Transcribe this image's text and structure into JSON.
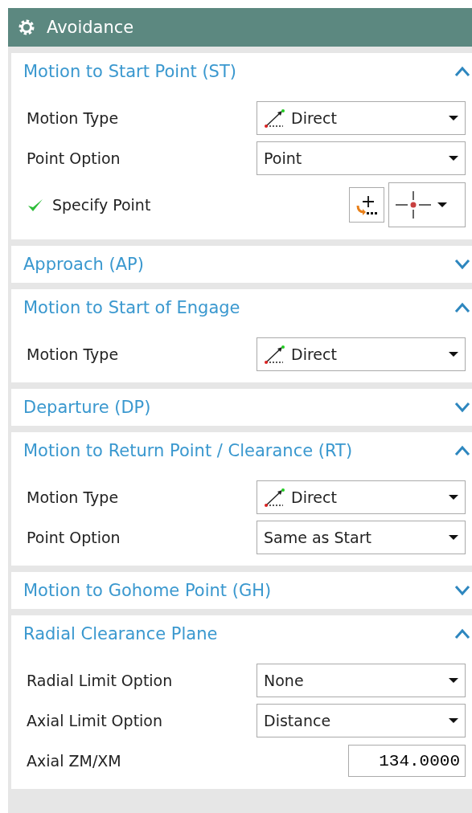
{
  "panel": {
    "title": "Avoidance"
  },
  "sections": [
    {
      "title": "Motion to Start Point (ST)",
      "expanded": true,
      "rows": [
        {
          "kind": "dropdown",
          "label": "Motion Type",
          "value": "Direct",
          "icon": true
        },
        {
          "kind": "dropdown",
          "label": "Point Option",
          "value": "Point",
          "icon": false
        },
        {
          "kind": "point",
          "label": "Specify Point",
          "specified": true
        }
      ]
    },
    {
      "title": "Approach (AP)",
      "expanded": false
    },
    {
      "title": "Motion to Start of Engage",
      "expanded": true,
      "rows": [
        {
          "kind": "dropdown",
          "label": "Motion Type",
          "value": "Direct",
          "icon": true
        }
      ]
    },
    {
      "title": "Departure (DP)",
      "expanded": false
    },
    {
      "title": "Motion to Return Point / Clearance (RT)",
      "expanded": true,
      "rows": [
        {
          "kind": "dropdown",
          "label": "Motion Type",
          "value": "Direct",
          "icon": true
        },
        {
          "kind": "dropdown",
          "label": "Point Option",
          "value": "Same as Start",
          "icon": false
        }
      ]
    },
    {
      "title": "Motion to Gohome Point (GH)",
      "expanded": false
    },
    {
      "title": "Radial Clearance Plane",
      "expanded": true,
      "rows": [
        {
          "kind": "dropdown",
          "label": "Radial Limit Option",
          "value": "None",
          "icon": false
        },
        {
          "kind": "dropdown",
          "label": "Axial Limit Option",
          "value": "Distance",
          "icon": false
        },
        {
          "kind": "number",
          "label": "Axial ZM/XM",
          "value": "134.0000"
        }
      ]
    }
  ]
}
